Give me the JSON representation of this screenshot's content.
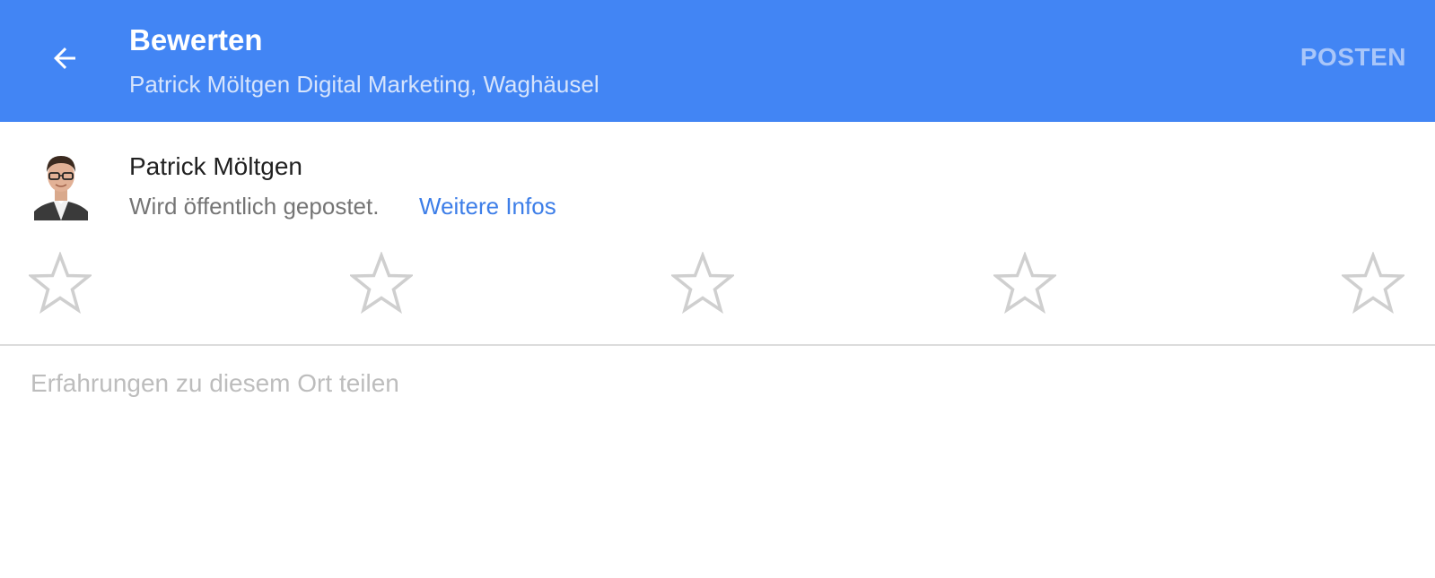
{
  "header": {
    "title": "Bewerten",
    "subtitle": "Patrick Möltgen Digital Marketing, Waghäusel",
    "post_label": "POSTEN",
    "back_icon": "arrow-left-icon"
  },
  "user": {
    "name": "Patrick Möltgen",
    "visibility_note": "Wird öffentlich gepostet.",
    "more_info_label": "Weitere Infos"
  },
  "rating": {
    "selected": 0,
    "max": 5,
    "icon": "star-outline-icon"
  },
  "review": {
    "placeholder": "Erfahrungen zu diesem Ort teilen",
    "value": ""
  },
  "colors": {
    "app_bar": "#4285f4",
    "link": "#3d7ee8",
    "star_outline": "#cfcfcf"
  }
}
